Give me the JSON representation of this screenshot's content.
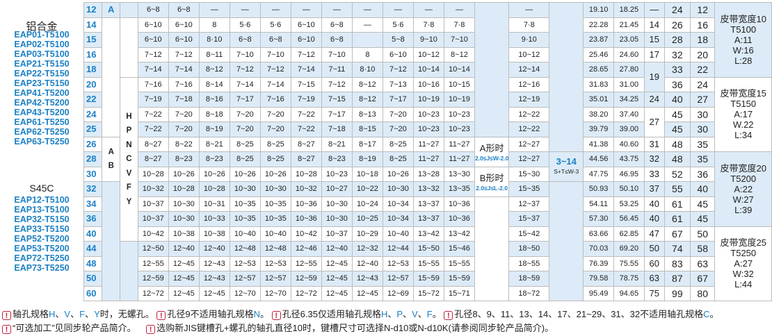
{
  "left_panel": {
    "title_alu": "铝合金",
    "models_alu": [
      "EAP01-T5100",
      "EAP02-T5100",
      "EAP03-T5100",
      "EAP21-T5150",
      "EAP22-T5150",
      "EAP23-T5150",
      "EAP41-T5200",
      "EAP42-T5200",
      "EAP43-T5200",
      "EAP61-T5250",
      "EAP62-T5250",
      "EAP63-T5250"
    ],
    "title_steel": "S45C",
    "models_steel": [
      "EAP12-T5100",
      "EAP13-T5100",
      "EAP32-T5150",
      "EAP33-T5150",
      "EAP52-T5200",
      "EAP53-T5200",
      "EAP72-T5250",
      "EAP73-T5250"
    ]
  },
  "table": {
    "rows": [
      {
        "d": "12",
        "c": [
          "6~8",
          "6~8",
          "—",
          "—",
          "—",
          "—",
          "—",
          "—",
          "—",
          "—",
          "—",
          "—",
          "19.10",
          "18.25",
          "—",
          "24",
          "12"
        ]
      },
      {
        "d": "14",
        "c": [
          "6~10",
          "6~10",
          "8",
          "5·6",
          "5·6",
          "6~10",
          "6~8",
          "—",
          "5·6",
          "7·8",
          "7·8",
          "7·8",
          "22.28",
          "21.45",
          "14",
          "26",
          "16"
        ]
      },
      {
        "d": "15",
        "c": [
          "6~10",
          "6~10",
          "8·10",
          "6~8",
          "6~8",
          "6~10",
          "6~8",
          "",
          "5~8",
          "9~10",
          "7~10",
          "9·10",
          "23.87",
          "23.05",
          "15",
          "28",
          "18"
        ]
      },
      {
        "d": "16",
        "c": [
          "7~12",
          "7~12",
          "8~11",
          "7~10",
          "7~10",
          "7~12",
          "7~10",
          "8",
          "6~10",
          "10~12",
          "8~12",
          "10~12",
          "25.46",
          "24.60",
          "17",
          "32",
          "20"
        ]
      },
      {
        "d": "18",
        "c": [
          "7~14",
          "7~14",
          "8~12",
          "7~12",
          "7~12",
          "7~14",
          "7~11",
          "8·10",
          "7~12",
          "10~14",
          "10~14",
          "12~14",
          "28.65",
          "27.80",
          "",
          "33",
          "22"
        ]
      },
      {
        "d": "20",
        "c": [
          "7~16",
          "7~16",
          "8~14",
          "7~14",
          "7~14",
          "7~15",
          "7~12",
          "8~12",
          "7~13",
          "10~16",
          "10~15",
          "12~16",
          "31.83",
          "31.00",
          "19",
          "36",
          "24"
        ]
      },
      {
        "d": "22",
        "c": [
          "7~19",
          "7~18",
          "8~16",
          "7~17",
          "7~16",
          "7~19",
          "7~15",
          "8~12",
          "7~17",
          "10~19",
          "10~19",
          "12~19",
          "35.01",
          "34.25",
          "24",
          "40",
          "27"
        ]
      },
      {
        "d": "24",
        "c": [
          "7~22",
          "7~20",
          "8~18",
          "7~20",
          "7~20",
          "7~22",
          "7~17",
          "8~13",
          "7~20",
          "10~23",
          "10~23",
          "12~22",
          "38.20",
          "37.40",
          "",
          "45",
          "30"
        ]
      },
      {
        "d": "25",
        "c": [
          "7~22",
          "7~20",
          "8~19",
          "7~20",
          "7~20",
          "7~22",
          "7~18",
          "8~15",
          "7~20",
          "10~23",
          "10~23",
          "12~22",
          "39.79",
          "39.00",
          "27",
          "45",
          "30"
        ]
      },
      {
        "d": "26",
        "c": [
          "8~27",
          "8~22",
          "8~21",
          "8~25",
          "8~25",
          "8~27",
          "8~21",
          "8~17",
          "8~25",
          "11~27",
          "11~27",
          "12~27",
          "41.38",
          "40.60",
          "31",
          "48",
          "35"
        ]
      },
      {
        "d": "28",
        "c": [
          "8~27",
          "8~23",
          "8~23",
          "8~25",
          "8~25",
          "8~27",
          "8~23",
          "8~19",
          "8~25",
          "11~27",
          "11~27",
          "12~27",
          "44.56",
          "43.75",
          "32",
          "48",
          "35"
        ]
      },
      {
        "d": "30",
        "c": [
          "10~28",
          "10~26",
          "10~26",
          "10~26",
          "10~26",
          "10~28",
          "10~23",
          "10~18",
          "10~26",
          "13~28",
          "13~30",
          "15~30",
          "47.75",
          "46.95",
          "33",
          "52",
          "36"
        ]
      },
      {
        "d": "32",
        "c": [
          "10~32",
          "10~28",
          "10~28",
          "10~30",
          "10~30",
          "10~32",
          "10~27",
          "10~22",
          "10~30",
          "13~32",
          "13~35",
          "15~35",
          "50.93",
          "50.10",
          "37",
          "55",
          "40"
        ]
      },
      {
        "d": "34",
        "c": [
          "10~37",
          "10~30",
          "10~31",
          "10~35",
          "10~35",
          "10~36",
          "10~30",
          "10~24",
          "10~34",
          "13~37",
          "10~36",
          "12~37",
          "54.11",
          "53.25",
          "40",
          "61",
          "45"
        ]
      },
      {
        "d": "36",
        "c": [
          "10~37",
          "10~30",
          "10~33",
          "10~35",
          "10~35",
          "10~36",
          "10~30",
          "10~25",
          "10~34",
          "13~37",
          "10~36",
          "15~37",
          "57.30",
          "56.45",
          "40",
          "61",
          "45"
        ]
      },
      {
        "d": "40",
        "c": [
          "10~42",
          "10~38",
          "10~38",
          "10~40",
          "10~40",
          "10~42",
          "10~37",
          "10~29",
          "10~40",
          "13~42",
          "13~42",
          "15~42",
          "63.66",
          "62.85",
          "47",
          "67",
          "50"
        ]
      },
      {
        "d": "44",
        "c": [
          "12~50",
          "12~40",
          "12~40",
          "12~48",
          "12~48",
          "12~46",
          "12~40",
          "12~32",
          "12~44",
          "15~50",
          "15~46",
          "18~50",
          "70.03",
          "69.20",
          "50",
          "74",
          "58"
        ]
      },
      {
        "d": "48",
        "c": [
          "12~55",
          "12~45",
          "12~43",
          "12~53",
          "12~53",
          "12~55",
          "12~45",
          "12~40",
          "12~53",
          "15~55",
          "15~55",
          "18~55",
          "76.39",
          "75.55",
          "60",
          "83",
          "63"
        ]
      },
      {
        "d": "50",
        "c": [
          "12~59",
          "12~45",
          "12~43",
          "12~57",
          "12~57",
          "12~59",
          "12~45",
          "12~43",
          "12~57",
          "15~59",
          "15~59",
          "18~59",
          "79.58",
          "78.75",
          "63",
          "87",
          "67"
        ]
      },
      {
        "d": "60",
        "c": [
          "12~72",
          "12~45",
          "12~45",
          "12~70",
          "12~70",
          "12~72",
          "12~45",
          "12~45",
          "12~69",
          "15~72",
          "15~71",
          "18~72",
          "95.49",
          "94.65",
          "75",
          "99",
          "80"
        ]
      }
    ],
    "types_col1": [
      "A",
      "A",
      "B"
    ],
    "types_col2": [
      "H",
      "P",
      "N",
      "C",
      "V",
      "F",
      "Y"
    ],
    "ab_a_label": "A形时",
    "ab_a_sub": "2.0≤J≤W-2.0",
    "ab_b_label": "B形时",
    "ab_b_sub": "2.0≤J≤L-2.0",
    "j_label": "3~14",
    "j_sub": "S+T≤W-3",
    "bands": [
      {
        "title": "皮带宽度10",
        "model": "T5100",
        "a": "A:11",
        "w": "W:16",
        "l": "L:28"
      },
      {
        "title": "皮带宽度15",
        "model": "T5150",
        "a": "A:17",
        "w": "W.22",
        "l": "L:34"
      },
      {
        "title": "皮带宽度20",
        "model": "T5200",
        "a": "A:22",
        "w": "W:27",
        "l": "L:39"
      },
      {
        "title": "皮带宽度25",
        "model": "T5250",
        "a": "A:27",
        "w": "W:32",
        "l": "L:44"
      }
    ]
  },
  "notes": {
    "n1_a": "轴孔规格",
    "n1_b": "H",
    "n1_c": "、",
    "n1_d": "V",
    "n1_e": "、",
    "n1_f": "F",
    "n1_g": "、",
    "n1_h": "Y",
    "n1_i": "时，无螺孔。",
    "n2_a": "孔径9不适用轴孔规格",
    "n2_b": "N",
    "n2_c": "。",
    "n3_a": "孔径6.35仅适用轴孔规格",
    "n3_b": "H",
    "n3_c": "、",
    "n3_d": "P",
    "n3_e": "、",
    "n3_f": "V",
    "n3_g": "、",
    "n3_h": "F",
    "n3_i": "。",
    "n4_a": "孔径8、9、11、13、14、17、21~29、31、32不适用轴孔规格",
    "n4_b": "C",
    "n4_c": "。",
    "n5": "“可选加工”见同步轮产品简介。",
    "n6": "选购新JIS键槽孔+螺孔的轴孔直径10时，键槽尺寸可选择N-d10或N-d10K(请参阅同步轮产品简介)。",
    "warn_icon": "!"
  }
}
